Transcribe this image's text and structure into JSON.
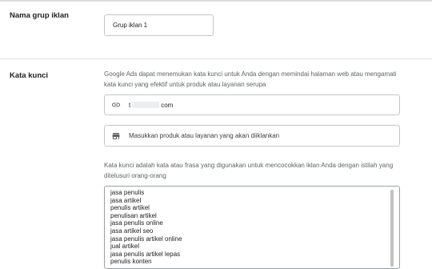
{
  "ad_group_name": {
    "label": "Nama grup iklan",
    "value": "Grup iklan 1"
  },
  "keywords": {
    "label": "Kata kunci",
    "description": "Google Ads dapat menemukan kata kunci untuk Anda dengan memindai halaman web atau mengamati kata kunci yang efektif untuk produk atau layanan serupa",
    "website_prefix": "t",
    "website_suffix": "com",
    "product_placeholder": "Masukkan produk atau layanan yang akan diiklankan",
    "list_description": "Kata kunci adalah kata atau frasa yang digunakan untuk mencocokkan iklan Anda dengan istilah yang ditelusuri orang-orang",
    "items": [
      "jasa penulis",
      "jasa artikel",
      "penulis artikel",
      "penulisan artikel",
      "jasa penulis online",
      "jasa artikel seo",
      "jasa penulis artikel online",
      "jual artikel",
      "jasa penulis artikel lepas",
      "penulis konten"
    ]
  },
  "icons": {
    "link": "link-icon",
    "store": "store-icon"
  }
}
